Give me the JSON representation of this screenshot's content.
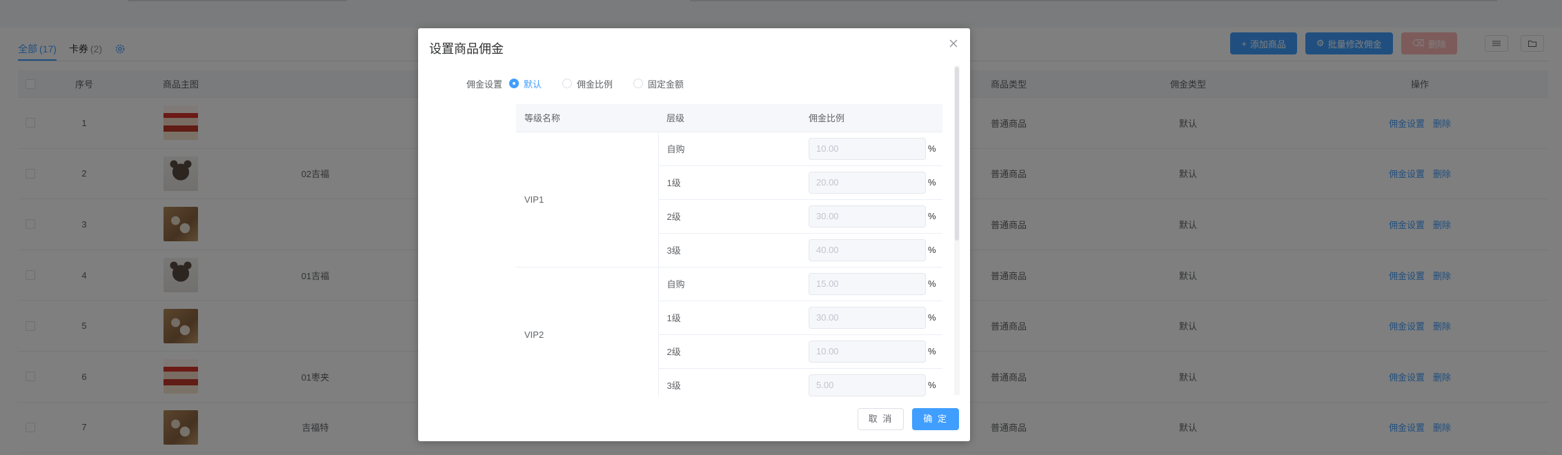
{
  "tabs": [
    {
      "label": "全部",
      "count": "(17)"
    },
    {
      "label": "卡券",
      "count": "(2)"
    }
  ],
  "toolbar": {
    "add_label": "添加商品",
    "batch_label": "批量修改佣金",
    "delete_label": "删除"
  },
  "table": {
    "headers": {
      "index": "序号",
      "image": "商品主图",
      "type": "商品类型",
      "commission_type": "佣金类型",
      "action": "操作"
    },
    "rows": [
      {
        "index": "1",
        "name": "",
        "type": "普通商品",
        "commission_type": "默认",
        "thumb": "red"
      },
      {
        "index": "2",
        "name": "02吉福",
        "type": "普通商品",
        "commission_type": "默认",
        "thumb": "bear"
      },
      {
        "index": "3",
        "name": "",
        "type": "普通商品",
        "commission_type": "默认",
        "thumb": "gift"
      },
      {
        "index": "4",
        "name": "01吉福",
        "type": "普通商品",
        "commission_type": "默认",
        "thumb": "bear"
      },
      {
        "index": "5",
        "name": "",
        "type": "普通商品",
        "commission_type": "默认",
        "thumb": "gift"
      },
      {
        "index": "6",
        "name": "01枣夹",
        "type": "普通商品",
        "commission_type": "默认",
        "thumb": "red"
      },
      {
        "index": "7",
        "name": "吉福特",
        "type": "普通商品",
        "commission_type": "默认",
        "thumb": "gift"
      }
    ],
    "action_setting": "佣金设置",
    "action_delete": "删除"
  },
  "dialog": {
    "title": "设置商品佣金",
    "form_label": "佣金设置",
    "options": [
      "默认",
      "佣金比例",
      "固定金额"
    ],
    "selected_option": "默认",
    "rate_headers": {
      "level_name": "等级名称",
      "tier": "层级",
      "rate": "佣金比例"
    },
    "percent": "%",
    "groups": [
      {
        "name": "VIP1",
        "tiers": [
          {
            "tier": "自购",
            "rate": "10.00"
          },
          {
            "tier": "1级",
            "rate": "20.00"
          },
          {
            "tier": "2级",
            "rate": "30.00"
          },
          {
            "tier": "3级",
            "rate": "40.00"
          }
        ]
      },
      {
        "name": "VIP2",
        "tiers": [
          {
            "tier": "自购",
            "rate": "15.00"
          },
          {
            "tier": "1级",
            "rate": "30.00"
          },
          {
            "tier": "2级",
            "rate": "10.00"
          },
          {
            "tier": "3级",
            "rate": "5.00"
          }
        ]
      }
    ],
    "cancel_label": "取 消",
    "ok_label": "确 定"
  },
  "colors": {
    "primary": "#409eff",
    "danger_disabled": "#fab6b6",
    "mask": "rgba(0,0,0,0.5)"
  }
}
